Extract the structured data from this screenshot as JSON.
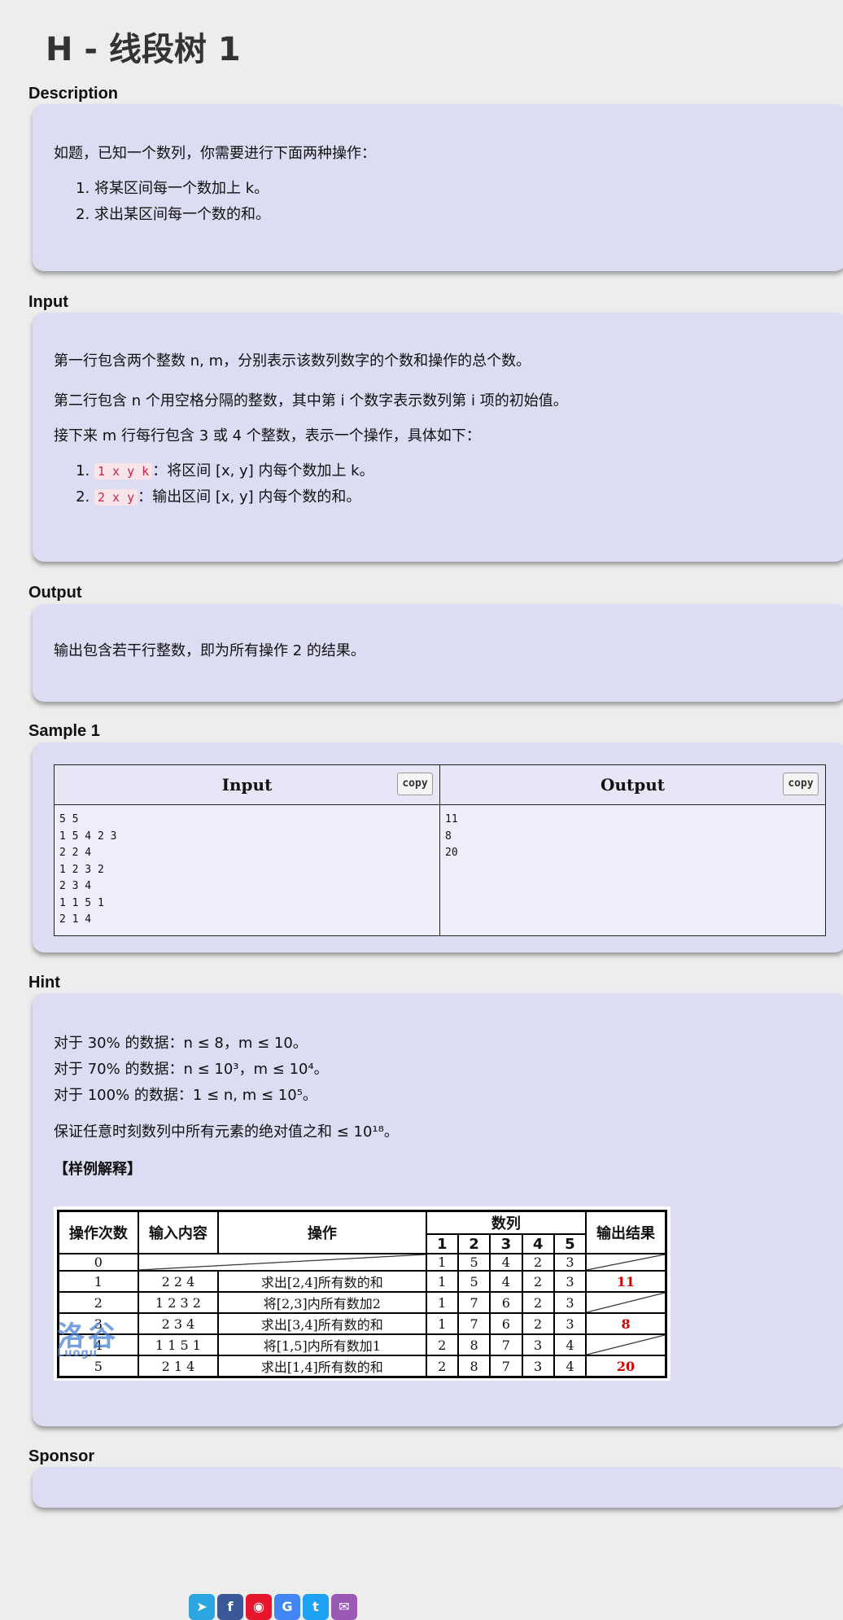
{
  "title": "H - 线段树 1",
  "sections": {
    "description": "Description",
    "input": "Input",
    "output": "Output",
    "sample": "Sample 1",
    "hint": "Hint",
    "sponsor": "Sponsor"
  },
  "description": {
    "intro": "如题，已知一个数列，你需要进行下面两种操作：",
    "ops": [
      "将某区间每一个数加上 k。",
      "求出某区间每一个数的和。"
    ]
  },
  "input": {
    "line1": "第一行包含两个整数 n, m，分别表示该数列数字的个数和操作的总个数。",
    "line2": "第二行包含 n 个用空格分隔的整数，其中第 i 个数字表示数列第 i 项的初始值。",
    "line3": "接下来 m 行每行包含 3 或 4 个整数，表示一个操作，具体如下：",
    "ops": [
      {
        "code": "1 x y k",
        "text": "：将区间 [x, y] 内每个数加上 k。"
      },
      {
        "code": "2 x y",
        "text": "：输出区间 [x, y] 内每个数的和。"
      }
    ]
  },
  "output": {
    "text": "输出包含若干行整数，即为所有操作 2 的结果。"
  },
  "sample": {
    "input_header": "Input",
    "output_header": "Output",
    "copy_label": "copy",
    "input_text": "5 5\n1 5 4 2 3\n2 2 4\n1 2 3 2\n2 3 4\n1 1 5 1\n2 1 4",
    "output_text": "11\n8\n20"
  },
  "hint": {
    "lines": [
      "对于 30% 的数据：n ≤ 8，m ≤ 10。",
      "对于 70% 的数据：n ≤ 10³，m ≤ 10⁴。",
      "对于 100% 的数据：1 ≤ n, m ≤ 10⁵。"
    ],
    "guarantee": "保证任意时刻数列中所有元素的绝对值之和 ≤ 10¹⁸。",
    "example_title": "【样例解释】",
    "table": {
      "headers": [
        "操作次数",
        "输入内容",
        "操作",
        "数列",
        "输出结果"
      ],
      "seq_cols": [
        "1",
        "2",
        "3",
        "4",
        "5"
      ],
      "rows": [
        {
          "n": "0",
          "input": "",
          "op": "",
          "seq": [
            "1",
            "5",
            "4",
            "2",
            "3"
          ],
          "out": ""
        },
        {
          "n": "1",
          "input": "2 2 4",
          "op": "求出[2,4]所有数的和",
          "seq": [
            "1",
            "5",
            "4",
            "2",
            "3"
          ],
          "out": "11"
        },
        {
          "n": "2",
          "input": "1 2 3 2",
          "op": "将[2,3]内所有数加2",
          "seq": [
            "1",
            "7",
            "6",
            "2",
            "3"
          ],
          "out": ""
        },
        {
          "n": "3",
          "input": "2 3 4",
          "op": "求出[3,4]所有数的和",
          "seq": [
            "1",
            "7",
            "6",
            "2",
            "3"
          ],
          "out": "8"
        },
        {
          "n": "4",
          "input": "1 1 5 1",
          "op": "将[1,5]内所有数加1",
          "seq": [
            "2",
            "8",
            "7",
            "3",
            "4"
          ],
          "out": ""
        },
        {
          "n": "5",
          "input": "2 1 4",
          "op": "求出[1,4]所有数的和",
          "seq": [
            "2",
            "8",
            "7",
            "3",
            "4"
          ],
          "out": "20"
        }
      ]
    },
    "watermark": "洛谷",
    "watermark_sub": "Luogu"
  },
  "share_icons": [
    "telegram-icon",
    "facebook-icon",
    "weibo-icon",
    "google-icon",
    "twitter-icon",
    "email-icon"
  ]
}
